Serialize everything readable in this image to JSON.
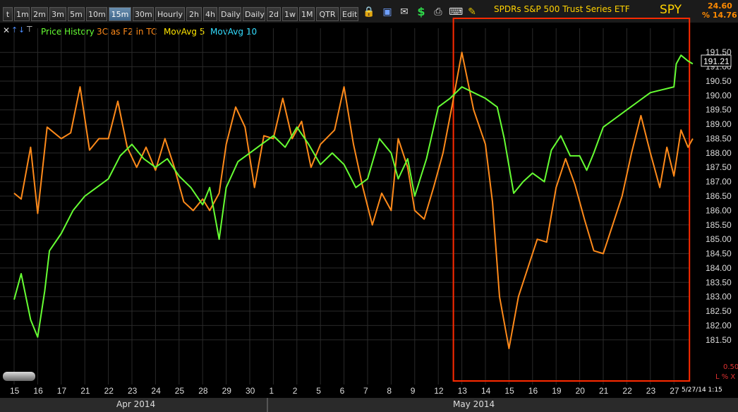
{
  "toolbar": {
    "timeframes": [
      "t",
      "1m",
      "2m",
      "3m",
      "5m",
      "10m",
      "15m",
      "30m",
      "Hourly",
      "2h",
      "4h",
      "Daily",
      "Daily",
      "2d",
      "1w",
      "1M",
      "QTR",
      "Edit"
    ],
    "active": "15m"
  },
  "header": {
    "title": "SPDRs S&P 500 Trust Series ETF",
    "symbol": "SPY",
    "price_change": "24.60",
    "pct_change": "% 14.76"
  },
  "legend": {
    "items": [
      {
        "label": "Price History",
        "color": "#66ff33"
      },
      {
        "label": "3C as F2 in TC",
        "color": "#ff8a1a"
      },
      {
        "label": "MovAvg 5",
        "color": "#ffe600"
      },
      {
        "label": "MovAvg 10",
        "color": "#33ddff"
      }
    ]
  },
  "price_label": "191.21",
  "bottom_right": {
    "value": "0.50",
    "flags": "L % X",
    "timestamp": "5/27/14 1:15"
  },
  "chart_data": {
    "type": "line",
    "title": "SPDRs S&P 500 Trust Series ETF",
    "symbol": "SPY",
    "interval": "15m",
    "x_tick_labels": [
      "15",
      "16",
      "17",
      "21",
      "22",
      "23",
      "24",
      "25",
      "28",
      "29",
      "30",
      "1",
      "2",
      "5",
      "6",
      "7",
      "8",
      "9",
      "12",
      "13",
      "14",
      "15",
      "16",
      "19",
      "20",
      "21",
      "22",
      "23",
      "27"
    ],
    "month_labels": [
      "Apr 2014",
      "May 2014"
    ],
    "y_ticks": [
      "191.50",
      "191.00",
      "190.50",
      "190.00",
      "189.50",
      "189.00",
      "188.50",
      "188.00",
      "187.50",
      "187.00",
      "186.50",
      "186.00",
      "185.50",
      "185.00",
      "184.50",
      "184.00",
      "183.50",
      "183.00",
      "182.50",
      "182.00",
      "181.50"
    ],
    "ylim": [
      181.2,
      191.8
    ],
    "grid": true,
    "last_price": 191.21,
    "highlight_box": {
      "from": "13",
      "to": "27",
      "color": "#ff2a00"
    },
    "series": [
      {
        "name": "Price History",
        "color": "#66ff33",
        "points": [
          [
            0,
            182.9
          ],
          [
            0.3,
            183.8
          ],
          [
            0.7,
            182.2
          ],
          [
            1.0,
            181.6
          ],
          [
            1.3,
            183.2
          ],
          [
            1.5,
            184.6
          ],
          [
            2,
            185.2
          ],
          [
            2.5,
            186.0
          ],
          [
            3,
            186.5
          ],
          [
            3.5,
            186.8
          ],
          [
            4,
            187.1
          ],
          [
            4.5,
            187.9
          ],
          [
            5,
            188.3
          ],
          [
            5.5,
            187.8
          ],
          [
            6,
            187.5
          ],
          [
            6.5,
            187.8
          ],
          [
            7,
            187.2
          ],
          [
            7.5,
            186.8
          ],
          [
            8,
            186.2
          ],
          [
            8.3,
            186.8
          ],
          [
            8.7,
            185.0
          ],
          [
            9,
            186.8
          ],
          [
            9.5,
            187.7
          ],
          [
            10,
            188.0
          ],
          [
            10.5,
            188.3
          ],
          [
            11,
            188.6
          ],
          [
            11.5,
            188.2
          ],
          [
            12,
            188.9
          ],
          [
            12.5,
            188.3
          ],
          [
            13,
            187.6
          ],
          [
            13.5,
            188.0
          ],
          [
            14,
            187.6
          ],
          [
            14.5,
            186.8
          ],
          [
            15,
            187.1
          ],
          [
            15.5,
            188.5
          ],
          [
            16,
            188.0
          ],
          [
            16.3,
            187.1
          ],
          [
            16.7,
            187.8
          ],
          [
            17,
            186.5
          ],
          [
            17.5,
            187.8
          ],
          [
            18,
            189.6
          ],
          [
            18.5,
            189.9
          ],
          [
            19,
            190.3
          ],
          [
            19.5,
            190.1
          ],
          [
            20,
            189.9
          ],
          [
            20.5,
            189.6
          ],
          [
            20.8,
            188.5
          ],
          [
            21.2,
            186.6
          ],
          [
            21.6,
            187.0
          ],
          [
            22,
            187.3
          ],
          [
            22.5,
            187.0
          ],
          [
            22.8,
            188.1
          ],
          [
            23.2,
            188.6
          ],
          [
            23.6,
            187.9
          ],
          [
            24,
            187.9
          ],
          [
            24.3,
            187.4
          ],
          [
            24.6,
            188.0
          ],
          [
            25,
            188.9
          ],
          [
            25.5,
            189.2
          ],
          [
            26,
            189.5
          ],
          [
            26.5,
            189.8
          ],
          [
            27,
            190.1
          ],
          [
            27.5,
            190.2
          ],
          [
            28,
            190.3
          ],
          [
            28.1,
            191.1
          ],
          [
            28.3,
            191.4
          ],
          [
            28.6,
            191.2
          ],
          [
            28.8,
            191.1
          ]
        ]
      },
      {
        "name": "3C as F2 in TC",
        "color": "#ff8a1a",
        "points": [
          [
            0,
            186.6
          ],
          [
            0.3,
            186.4
          ],
          [
            0.7,
            188.2
          ],
          [
            1,
            185.9
          ],
          [
            1.4,
            188.9
          ],
          [
            2,
            188.5
          ],
          [
            2.4,
            188.7
          ],
          [
            2.8,
            190.3
          ],
          [
            3.2,
            188.1
          ],
          [
            3.6,
            188.5
          ],
          [
            4,
            188.5
          ],
          [
            4.4,
            189.8
          ],
          [
            4.8,
            188.2
          ],
          [
            5.2,
            187.5
          ],
          [
            5.6,
            188.2
          ],
          [
            6,
            187.4
          ],
          [
            6.4,
            188.5
          ],
          [
            6.8,
            187.5
          ],
          [
            7.2,
            186.3
          ],
          [
            7.6,
            186.0
          ],
          [
            8,
            186.4
          ],
          [
            8.3,
            186.0
          ],
          [
            8.7,
            186.6
          ],
          [
            9,
            188.3
          ],
          [
            9.4,
            189.6
          ],
          [
            9.8,
            188.9
          ],
          [
            10.2,
            186.8
          ],
          [
            10.6,
            188.6
          ],
          [
            11.0,
            188.5
          ],
          [
            11.4,
            189.9
          ],
          [
            11.8,
            188.5
          ],
          [
            12.2,
            189.1
          ],
          [
            12.6,
            187.5
          ],
          [
            13,
            188.3
          ],
          [
            13.6,
            188.8
          ],
          [
            14,
            190.3
          ],
          [
            14.4,
            188.3
          ],
          [
            14.8,
            186.8
          ],
          [
            15.2,
            185.5
          ],
          [
            15.6,
            186.6
          ],
          [
            16,
            186.0
          ],
          [
            16.3,
            188.5
          ],
          [
            16.7,
            187.5
          ],
          [
            17,
            186.0
          ],
          [
            17.4,
            185.7
          ],
          [
            17.8,
            186.8
          ],
          [
            18.2,
            188.0
          ],
          [
            18.6,
            189.7
          ],
          [
            19,
            191.5
          ],
          [
            19.5,
            189.5
          ],
          [
            20,
            188.3
          ],
          [
            20.3,
            186.3
          ],
          [
            20.6,
            183.0
          ],
          [
            21,
            181.2
          ],
          [
            21.4,
            183.0
          ],
          [
            21.8,
            184.0
          ],
          [
            22.2,
            185.0
          ],
          [
            22.6,
            184.9
          ],
          [
            23,
            186.8
          ],
          [
            23.4,
            187.8
          ],
          [
            23.8,
            186.9
          ],
          [
            24.2,
            185.7
          ],
          [
            24.6,
            184.6
          ],
          [
            25,
            184.5
          ],
          [
            25.4,
            185.5
          ],
          [
            25.8,
            186.5
          ],
          [
            26.2,
            188.0
          ],
          [
            26.6,
            189.3
          ],
          [
            27,
            188.0
          ],
          [
            27.4,
            186.8
          ],
          [
            27.7,
            188.2
          ],
          [
            28,
            187.2
          ],
          [
            28.3,
            188.8
          ],
          [
            28.6,
            188.2
          ],
          [
            28.8,
            188.5
          ]
        ]
      }
    ]
  }
}
